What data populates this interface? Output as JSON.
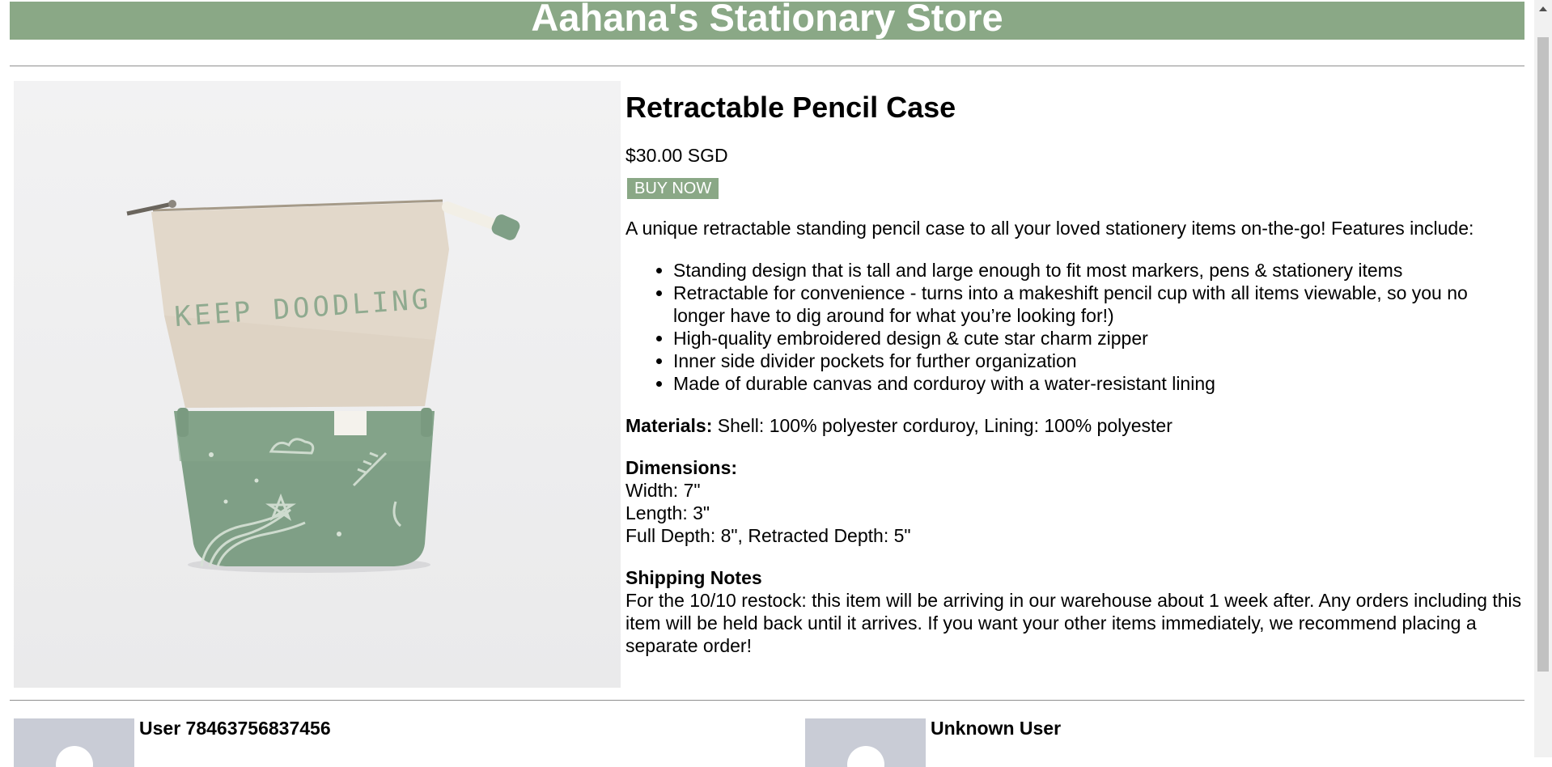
{
  "store": {
    "title": "Aahana's Stationary Store"
  },
  "product": {
    "image_alt": "Retractable pencil case with KEEP DOODLING embroidery",
    "embroidery": "KEEP DOODLING",
    "title": "Retractable Pencil Case",
    "price": "$30.00 SGD",
    "buy_label": "BUY NOW",
    "intro": "A unique retractable standing pencil case to all your loved stationery items on-the-go! Features include:",
    "features": [
      "Standing design that is tall and large enough to fit most markers, pens & stationery items",
      "Retractable for convenience - turns into a makeshift pencil cup with all items viewable, so you no longer have to dig around for what you’re looking for!)",
      "High-quality embroidered design & cute star charm zipper",
      "Inner side divider pockets for further organization",
      "Made of durable canvas and corduroy with a water-resistant lining"
    ],
    "materials_label": "Materials:",
    "materials_value": "Shell: 100% polyester corduroy, Lining: 100% polyester",
    "dimensions_label": "Dimensions:",
    "dimensions": [
      "Width: 7\"",
      "Length: 3\"",
      "Full Depth: 8\", Retracted Depth: 5\""
    ],
    "shipping_label": "Shipping Notes",
    "shipping_text": "For the 10/10 restock: this item will be arriving in our warehouse about 1 week after. Any orders including this item will be held back until it arrives. If you want your other items immediately, we recommend placing a separate order!"
  },
  "reviews": [
    {
      "user": "User 78463756837456"
    },
    {
      "user": "Unknown User"
    }
  ],
  "colors": {
    "accent": "#8aa886",
    "avatar_bg": "#c9ccd6"
  }
}
